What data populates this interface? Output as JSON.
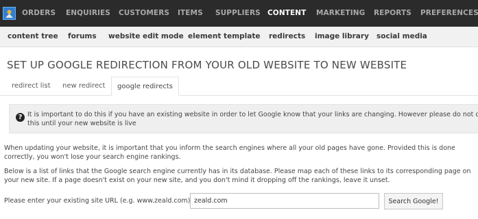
{
  "topnav": {
    "logo_icon": "zeald-logo-icon",
    "items": [
      {
        "label": "ORDERS"
      },
      {
        "label": "ENQUIRIES"
      },
      {
        "label": "CUSTOMERS"
      },
      {
        "label": "ITEMS"
      },
      {
        "label": "SUPPLIERS"
      },
      {
        "label": "CONTENT",
        "active": true
      },
      {
        "label": "MARKETING"
      },
      {
        "label": "REPORTS"
      },
      {
        "label": "PREFERENCES"
      }
    ]
  },
  "subnav": {
    "items": [
      {
        "label": "content tree"
      },
      {
        "label": "forums"
      },
      {
        "label": "website edit mode"
      },
      {
        "label": "element template"
      },
      {
        "label": "redirects"
      },
      {
        "label": "image library"
      },
      {
        "label": "social media"
      }
    ]
  },
  "page": {
    "title": "SET UP GOOGLE REDIRECTION FROM YOUR OLD WEBSITE TO NEW WEBSITE"
  },
  "tabs": [
    {
      "label": "redirect list"
    },
    {
      "label": "new redirect"
    },
    {
      "label": "google redirects",
      "active": true
    }
  ],
  "notice": {
    "icon": "question-icon",
    "text": "It is important to do this if you have an existing website in order to let Google know that your links are changing. However please do not do this until your new website is live"
  },
  "body": {
    "paragraph1": "When updating your website, it is important that you inform the search engines where all your old pages have gone. Provided this is done correctly, you won't lose your search engine rankings.",
    "paragraph2": "Below is a list of links that the Google search engine currently has in its database. Please map each of these links to its corresponding page on your new site. If a page doesn't exist on your new site, and you don't mind it dropping off the rankings, leave it unset."
  },
  "form": {
    "label": "Please enter your existing site URL (e.g. www.zeald.com):",
    "url_value": "zeald.com",
    "button_label": "Search Google!"
  },
  "colors": {
    "topbar_bg": "#2b2b2b",
    "subnav_bg": "#f1f1f1",
    "logo_blue": "#2f7fd1"
  }
}
